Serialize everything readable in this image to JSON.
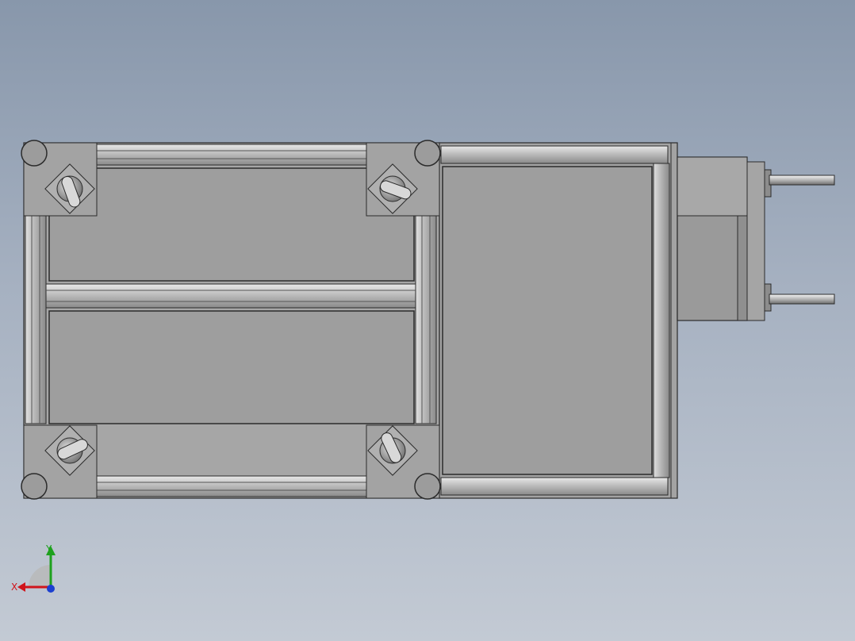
{
  "viewport": {
    "background_top": "#8897ab",
    "background_bottom": "#c3cad4"
  },
  "model": {
    "description_colors": {
      "frame": "#a9a9a9",
      "panel": "#9e9e9e",
      "outline": "#2b2b2b"
    },
    "icons": [
      "caster-wheel-icon",
      "motor-icon",
      "shaft-icon"
    ]
  },
  "triad": {
    "x_label": "X",
    "y_label": "Y",
    "x_color": "#d0141b",
    "y_color": "#1ea11e",
    "z_color": "#1b3fd0"
  }
}
